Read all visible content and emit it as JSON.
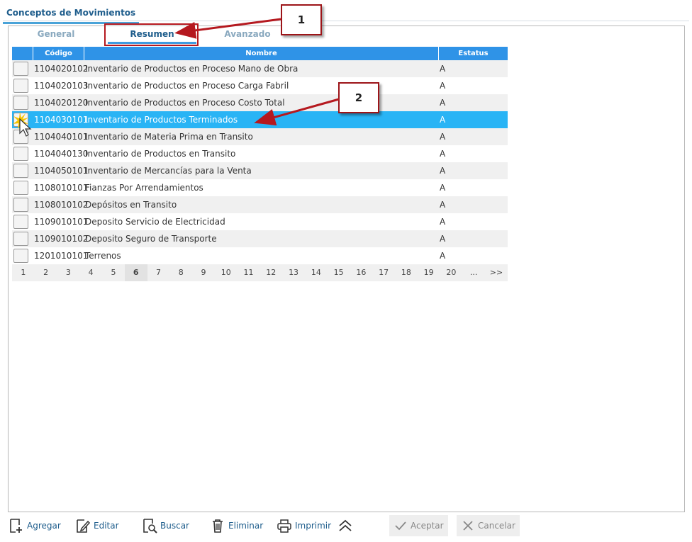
{
  "window": {
    "title": "Conceptos de Movimientos"
  },
  "tabs": [
    {
      "label": "General"
    },
    {
      "label": "Resumen"
    },
    {
      "label": "Avanzado"
    }
  ],
  "grid": {
    "columns": [
      "Código",
      "Nombre",
      "Estatus"
    ],
    "rows": [
      {
        "code": "1104020102",
        "name": "Inventario de Productos en Proceso Mano de Obra",
        "status": "A"
      },
      {
        "code": "1104020103",
        "name": "Inventario de Productos en Proceso Carga Fabril",
        "status": "A"
      },
      {
        "code": "1104020120",
        "name": "Inventario de Productos en Proceso Costo Total",
        "status": "A"
      },
      {
        "code": "1104030101",
        "name": "Inventario de Productos Terminados",
        "status": "A"
      },
      {
        "code": "1104040101",
        "name": "Inventario de Materia Prima en Transito",
        "status": "A"
      },
      {
        "code": "1104040130",
        "name": "Inventario de Productos en Transito",
        "status": "A"
      },
      {
        "code": "1104050101",
        "name": "Inventario de Mercancías para la Venta",
        "status": "A"
      },
      {
        "code": "1108010101",
        "name": "Fianzas Por Arrendamientos",
        "status": "A"
      },
      {
        "code": "1108010102",
        "name": "Depósitos en Transito",
        "status": "A"
      },
      {
        "code": "1109010101",
        "name": "Deposito Servicio de Electricidad",
        "status": "A"
      },
      {
        "code": "1109010102",
        "name": "Deposito Seguro de Transporte",
        "status": "A"
      },
      {
        "code": "1201010101",
        "name": "Terrenos",
        "status": "A"
      }
    ],
    "selected_row_index": 3,
    "pager": [
      "1",
      "2",
      "3",
      "4",
      "5",
      "6",
      "7",
      "8",
      "9",
      "10",
      "11",
      "12",
      "13",
      "14",
      "15",
      "16",
      "17",
      "18",
      "19",
      "20",
      "...",
      ">>"
    ],
    "current_page": "6"
  },
  "callouts": {
    "one": "1",
    "two": "2"
  },
  "toolbar": {
    "agregar": "Agregar",
    "editar": "Editar",
    "buscar": "Buscar",
    "eliminar": "Eliminar",
    "imprimir": "Imprimir",
    "aceptar": "Aceptar",
    "cancelar": "Cancelar"
  },
  "colors": {
    "header_blue": "#2f93e7",
    "selected_row": "#29b4f5",
    "callout_border": "#9c1418",
    "link_blue": "#1e5d8c"
  }
}
